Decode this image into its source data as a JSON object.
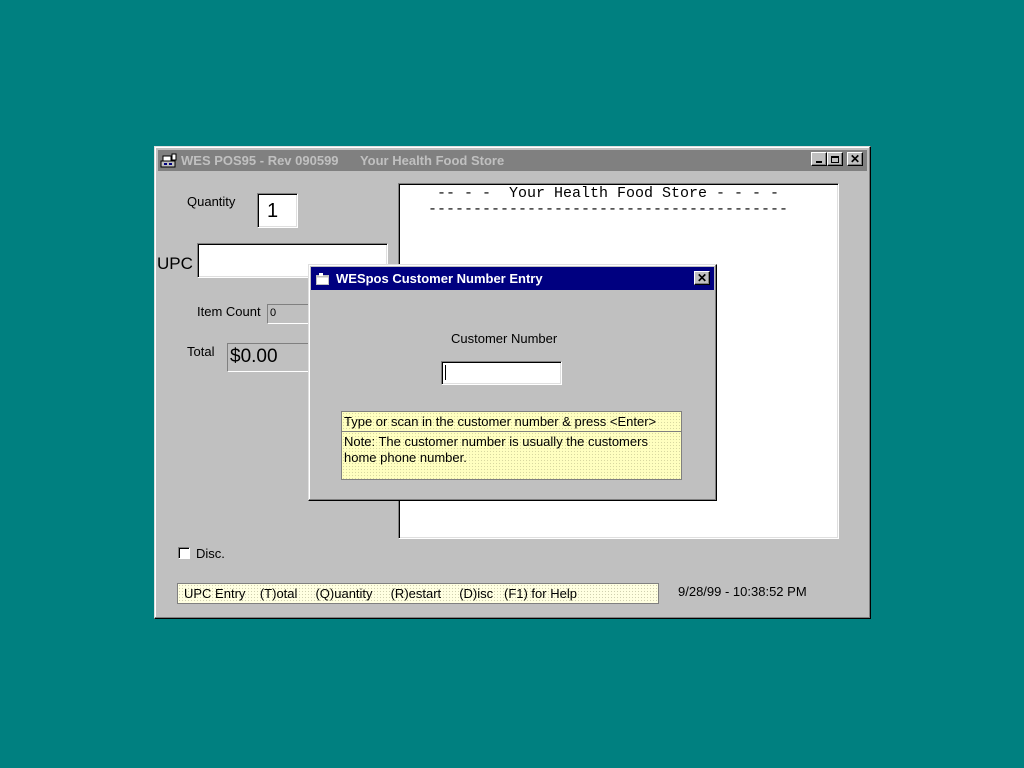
{
  "main_window": {
    "title": "WES POS95 - Rev 090599      Your Health Food Store",
    "quantity_label": "Quantity",
    "quantity_value": "1",
    "upc_label": "UPC",
    "upc_value": "",
    "item_count_label": "Item Count",
    "item_count_value": "0",
    "total_label": "Total",
    "total_value": "$0.00",
    "receipt_header": "-- - -  Your Health Food Store - - - -",
    "receipt_rule": "----------------------------------------",
    "disc_label": "Disc.",
    "disc_checked": false,
    "status_hint": "UPC Entry    (T)otal     (Q)uantity     (R)estart     (D)isc   (F1) for Help",
    "datetime": "9/28/99 - 10:38:52 PM"
  },
  "dialog": {
    "title": "WESpos Customer Number Entry",
    "field_label": "Customer Number",
    "field_value": "",
    "instruction": "Type or scan in the customer number  &  press <Enter>",
    "note": "Note:  The customer number is usually the customers home phone number."
  },
  "icons": {
    "app_icon": "pos-register-icon",
    "dialog_icon": "window-icon",
    "minimize": "minimize-icon",
    "maximize": "maximize-icon",
    "close": "close-icon"
  },
  "colors": {
    "desktop": "#008080",
    "window_face": "#c0c0c0",
    "active_title": "#000080",
    "inactive_title": "#808080",
    "tooltip_yellow": "#ffffc0"
  }
}
